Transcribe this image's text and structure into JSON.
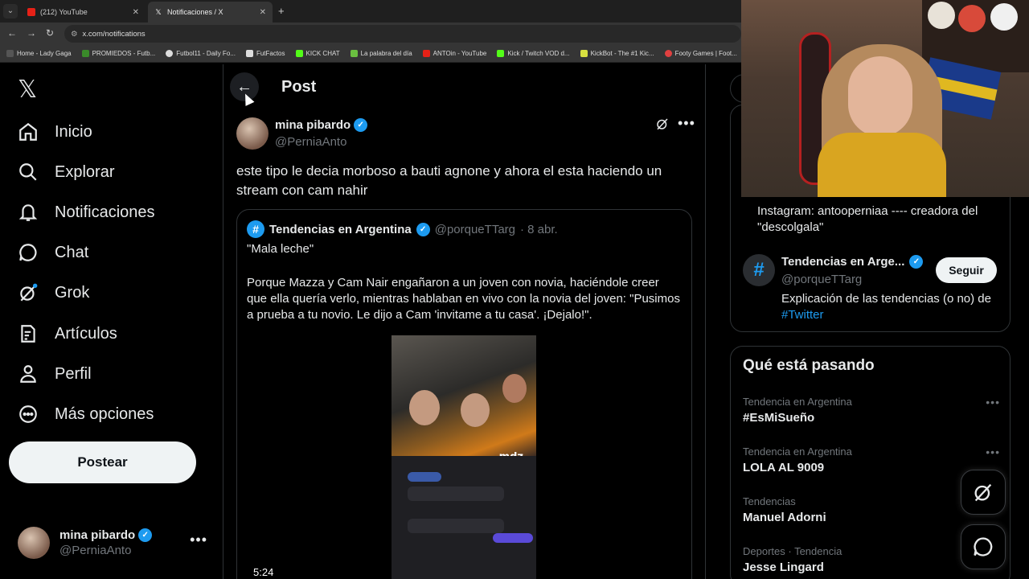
{
  "browser": {
    "tabs": [
      {
        "title": "(212) YouTube",
        "active": false
      },
      {
        "title": "Notificaciones / X",
        "active": true
      }
    ],
    "url": "x.com/notifications",
    "bookmarks": [
      "Home - Lady Gaga",
      "PROMIEDOS - Futb...",
      "Futbol11 - Daily Fo...",
      "FutFactos",
      "KICK CHAT",
      "La palabra del día",
      "ANTOin - YouTube",
      "Kick / Twitch VOD d...",
      "KickBot - The #1 Kic...",
      "Footy Games | Foot..."
    ]
  },
  "nav": {
    "items": [
      {
        "label": "Inicio",
        "icon": "home-icon"
      },
      {
        "label": "Explorar",
        "icon": "search-icon"
      },
      {
        "label": "Notificaciones",
        "icon": "bell-icon"
      },
      {
        "label": "Chat",
        "icon": "chat-icon"
      },
      {
        "label": "Grok",
        "icon": "grok-icon"
      },
      {
        "label": "Artículos",
        "icon": "articles-icon"
      },
      {
        "label": "Perfil",
        "icon": "person-icon"
      },
      {
        "label": "Más opciones",
        "icon": "more-circle-icon"
      }
    ],
    "post_button": "Postear",
    "account": {
      "name": "mina pibardo",
      "handle": "@PerniaAnto"
    }
  },
  "main": {
    "title": "Post",
    "post": {
      "author_name": "mina pibardo",
      "author_handle": "@PerniaAnto",
      "text": "este tipo le decia morboso a bauti agnone y ahora el esta haciendo un stream con cam nahir"
    },
    "quote": {
      "name": "Tendencias en Argentina",
      "handle": "@porqueTTarg",
      "date": "· 8 abr.",
      "headline": "\"Mala leche\"",
      "body": "Porque Mazza y Cam Nair engañaron a un joven con novia, haciéndole creer que ella quería verlo, mientras hablaban en vivo con la novia del joven: \"Pusimos a prueba a tu novio. Le dijo a Cam 'invitame a tu casa'. ¡Dejalo!\".",
      "video_duration": "5:24",
      "video_watermark": "mdz"
    }
  },
  "right": {
    "bio": "Instagram: antooperniaa ---- creadora del \"descolgala\"",
    "suggested": {
      "name": "Tendencias en Arge...",
      "handle": "@porqueTTarg",
      "follow_label": "Seguir",
      "bio_prefix": "Explicación de las tendencias (o no) de",
      "bio_link": "#Twitter"
    },
    "whats_happening": {
      "title": "Qué está pasando",
      "trends": [
        {
          "category": "Tendencia en Argentina",
          "name": "#EsMiSueño"
        },
        {
          "category": "Tendencia en Argentina",
          "name": "LOLA AL 9009"
        },
        {
          "category": "Tendencias",
          "name": "Manuel Adorni"
        },
        {
          "category": "Deportes · Tendencia",
          "name": "Jesse Lingard"
        }
      ]
    }
  },
  "colors": {
    "accent": "#1d9bf0",
    "background": "#000000",
    "text": "#e7e9ea",
    "muted": "#71767b",
    "border": "#2f3336"
  }
}
